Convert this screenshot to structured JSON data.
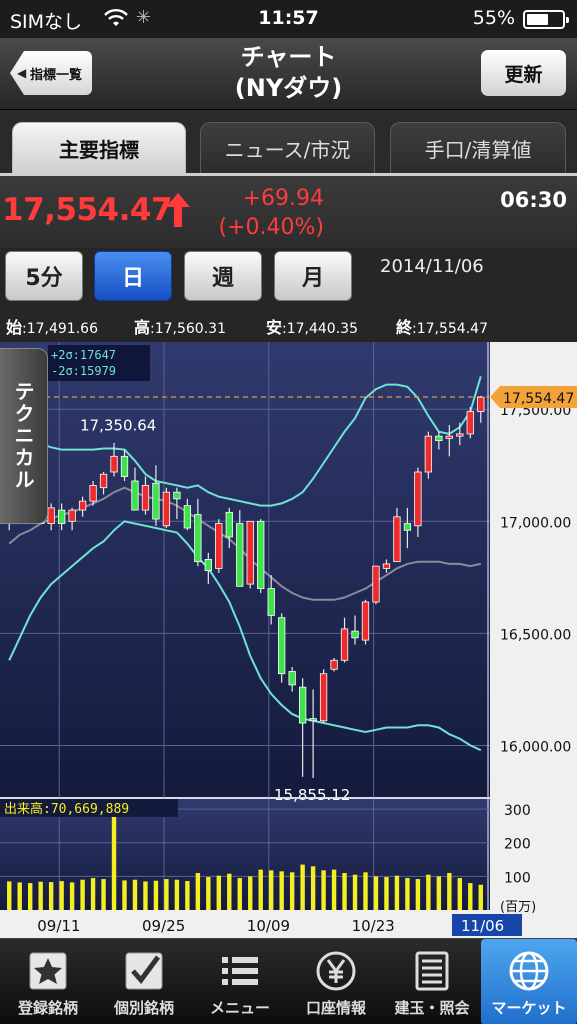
{
  "status_bar": {
    "carrier": "SIMなし",
    "time": "11:57",
    "battery": "55%",
    "battery_level": 0.55
  },
  "nav": {
    "back_label": "指標一覧",
    "title_line1": "チャート",
    "title_line2": "(NYダウ)",
    "refresh_label": "更新"
  },
  "tabs": [
    {
      "label": "主要指標",
      "active": true
    },
    {
      "label": "ニュース/市況",
      "active": false
    },
    {
      "label": "手口/清算値",
      "active": false
    }
  ],
  "quote": {
    "price": "17,554.47",
    "change": "+69.94",
    "change_pct": "(+0.40%)",
    "time": "06:30",
    "up_color": "#ff3b3b"
  },
  "periods": [
    {
      "label": "5分",
      "active": false
    },
    {
      "label": "日",
      "active": true
    },
    {
      "label": "週",
      "active": false
    },
    {
      "label": "月",
      "active": false
    }
  ],
  "date": "2014/11/06",
  "ohlc": {
    "open_label": "始",
    "open": ":17,491.66",
    "high_label": "高",
    "high": ":17,560.31",
    "low_label": "安",
    "low": ":17,440.35",
    "close_label": "終",
    "close": ":17,554.47"
  },
  "technical_tab": "テクニカル",
  "chart_data": {
    "type": "candlestick",
    "y_ticks": [
      "17,500.00",
      "17,000.00",
      "16,500.00",
      "16,000.00"
    ],
    "y_tick_values": [
      17500,
      17000,
      16500,
      16000
    ],
    "ylim": [
      15770,
      17800
    ],
    "x_ticks": [
      "09/11",
      "09/25",
      "10/09",
      "10/23",
      "11/06"
    ],
    "current_price_label": "17,554.47",
    "current_price": 17554.47,
    "bollinger_legend": [
      "+2σ:17647",
      "-2σ:15979"
    ],
    "annotations": [
      {
        "text": "17,350.64",
        "value": 17350.64
      },
      {
        "text": "15,855.12",
        "value": 15855.12
      }
    ],
    "candles": [
      {
        "o": 17010,
        "h": 17070,
        "l": 16960,
        "c": 17060
      },
      {
        "o": 17070,
        "h": 17120,
        "l": 17040,
        "c": 17080
      },
      {
        "o": 17050,
        "h": 17100,
        "l": 16990,
        "c": 17040
      },
      {
        "o": 17060,
        "h": 17110,
        "l": 16990,
        "c": 16990
      },
      {
        "o": 16990,
        "h": 17080,
        "l": 16960,
        "c": 17060
      },
      {
        "o": 17050,
        "h": 17080,
        "l": 16960,
        "c": 16990
      },
      {
        "o": 17000,
        "h": 17060,
        "l": 16960,
        "c": 17050
      },
      {
        "o": 17050,
        "h": 17110,
        "l": 17020,
        "c": 17090
      },
      {
        "o": 17090,
        "h": 17180,
        "l": 17070,
        "c": 17160
      },
      {
        "o": 17150,
        "h": 17220,
        "l": 17120,
        "c": 17210
      },
      {
        "o": 17220,
        "h": 17350,
        "l": 17200,
        "c": 17290
      },
      {
        "o": 17290,
        "h": 17320,
        "l": 17180,
        "c": 17200
      },
      {
        "o": 17180,
        "h": 17240,
        "l": 17100,
        "c": 17050
      },
      {
        "o": 17050,
        "h": 17200,
        "l": 17030,
        "c": 17160
      },
      {
        "o": 17170,
        "h": 17250,
        "l": 16980,
        "c": 17010
      },
      {
        "o": 16980,
        "h": 17150,
        "l": 16970,
        "c": 17130
      },
      {
        "o": 17130,
        "h": 17150,
        "l": 17010,
        "c": 17100
      },
      {
        "o": 17070,
        "h": 17100,
        "l": 16960,
        "c": 16970
      },
      {
        "o": 17030,
        "h": 17100,
        "l": 16800,
        "c": 16820
      },
      {
        "o": 16830,
        "h": 16860,
        "l": 16720,
        "c": 16780
      },
      {
        "o": 16790,
        "h": 17010,
        "l": 16770,
        "c": 16990
      },
      {
        "o": 17040,
        "h": 17060,
        "l": 16880,
        "c": 16930
      },
      {
        "o": 16990,
        "h": 17050,
        "l": 16750,
        "c": 16710
      },
      {
        "o": 16720,
        "h": 17000,
        "l": 16700,
        "c": 17000
      },
      {
        "o": 17000,
        "h": 17010,
        "l": 16680,
        "c": 16700
      },
      {
        "o": 16700,
        "h": 16760,
        "l": 16540,
        "c": 16580
      },
      {
        "o": 16570,
        "h": 16590,
        "l": 16280,
        "c": 16320
      },
      {
        "o": 16330,
        "h": 16350,
        "l": 16240,
        "c": 16270
      },
      {
        "o": 16260,
        "h": 16300,
        "l": 15860,
        "c": 16100
      },
      {
        "o": 16120,
        "h": 16250,
        "l": 15855,
        "c": 16110
      },
      {
        "o": 16110,
        "h": 16340,
        "l": 16100,
        "c": 16320
      },
      {
        "o": 16340,
        "h": 16390,
        "l": 16330,
        "c": 16380
      },
      {
        "o": 16380,
        "h": 16570,
        "l": 16370,
        "c": 16520
      },
      {
        "o": 16510,
        "h": 16580,
        "l": 16450,
        "c": 16480
      },
      {
        "o": 16470,
        "h": 16650,
        "l": 16450,
        "c": 16640
      },
      {
        "o": 16640,
        "h": 16790,
        "l": 16630,
        "c": 16800
      },
      {
        "o": 16790,
        "h": 16830,
        "l": 16770,
        "c": 16810
      },
      {
        "o": 16820,
        "h": 17060,
        "l": 16820,
        "c": 17020
      },
      {
        "o": 16990,
        "h": 17060,
        "l": 16880,
        "c": 16960
      },
      {
        "o": 16980,
        "h": 17240,
        "l": 16930,
        "c": 17220
      },
      {
        "o": 17220,
        "h": 17400,
        "l": 17190,
        "c": 17380
      },
      {
        "o": 17380,
        "h": 17400,
        "l": 17320,
        "c": 17360
      },
      {
        "o": 17370,
        "h": 17430,
        "l": 17290,
        "c": 17380
      },
      {
        "o": 17380,
        "h": 17440,
        "l": 17340,
        "c": 17390
      },
      {
        "o": 17390,
        "h": 17510,
        "l": 17370,
        "c": 17490
      },
      {
        "o": 17490,
        "h": 17560,
        "l": 17440,
        "c": 17554
      }
    ],
    "upper_band": [
      17410,
      17400,
      17370,
      17345,
      17330,
      17320,
      17320,
      17320,
      17320,
      17325,
      17325,
      17320,
      17270,
      17210,
      17180,
      17170,
      17160,
      17150,
      17160,
      17130,
      17110,
      17100,
      17090,
      17080,
      17070,
      17070,
      17080,
      17100,
      17130,
      17190,
      17260,
      17330,
      17400,
      17460,
      17550,
      17590,
      17610,
      17610,
      17600,
      17550,
      17470,
      17400,
      17390,
      17420,
      17490,
      17647
    ],
    "lower_band": [
      16380,
      16480,
      16580,
      16660,
      16720,
      16760,
      16800,
      16840,
      16880,
      16910,
      16960,
      17000,
      16990,
      16980,
      16970,
      16960,
      16950,
      16900,
      16840,
      16790,
      16720,
      16640,
      16530,
      16400,
      16300,
      16230,
      16180,
      16140,
      16120,
      16110,
      16100,
      16090,
      16080,
      16070,
      16060,
      16070,
      16080,
      16080,
      16080,
      16090,
      16090,
      16080,
      16050,
      16030,
      16000,
      15979
    ],
    "moving_average": [
      16900,
      16940,
      16960,
      16990,
      17010,
      17030,
      17040,
      17060,
      17080,
      17100,
      17130,
      17150,
      17130,
      17110,
      17100,
      17090,
      17070,
      17040,
      17010,
      16980,
      16950,
      16920,
      16880,
      16830,
      16790,
      16750,
      16710,
      16680,
      16660,
      16650,
      16650,
      16650,
      16660,
      16680,
      16700,
      16730,
      16760,
      16790,
      16810,
      16820,
      16820,
      16820,
      16810,
      16810,
      16800,
      16810
    ],
    "volume": {
      "label": "出来高:70,669,889",
      "unit": "(百万)",
      "y_ticks": [
        "300",
        "200",
        "100"
      ],
      "y_tick_values": [
        300,
        200,
        100
      ],
      "ylim": [
        0,
        330
      ],
      "values": [
        85,
        82,
        80,
        84,
        83,
        86,
        82,
        90,
        95,
        92,
        300,
        88,
        90,
        85,
        87,
        92,
        90,
        86,
        110,
        98,
        102,
        108,
        95,
        100,
        120,
        118,
        115,
        112,
        135,
        130,
        118,
        120,
        110,
        105,
        112,
        100,
        98,
        102,
        95,
        92,
        105,
        100,
        110,
        95,
        80,
        75
      ]
    }
  },
  "tab_bar": [
    {
      "label": "登録銘柄",
      "icon": "star-icon",
      "active": false
    },
    {
      "label": "個別銘柄",
      "icon": "check-icon",
      "active": false
    },
    {
      "label": "メニュー",
      "icon": "menu-list-icon",
      "active": false
    },
    {
      "label": "口座情報",
      "icon": "yen-icon",
      "active": false
    },
    {
      "label": "建玉・照会",
      "icon": "document-icon",
      "active": false
    },
    {
      "label": "マーケット",
      "icon": "globe-icon",
      "active": true
    }
  ]
}
